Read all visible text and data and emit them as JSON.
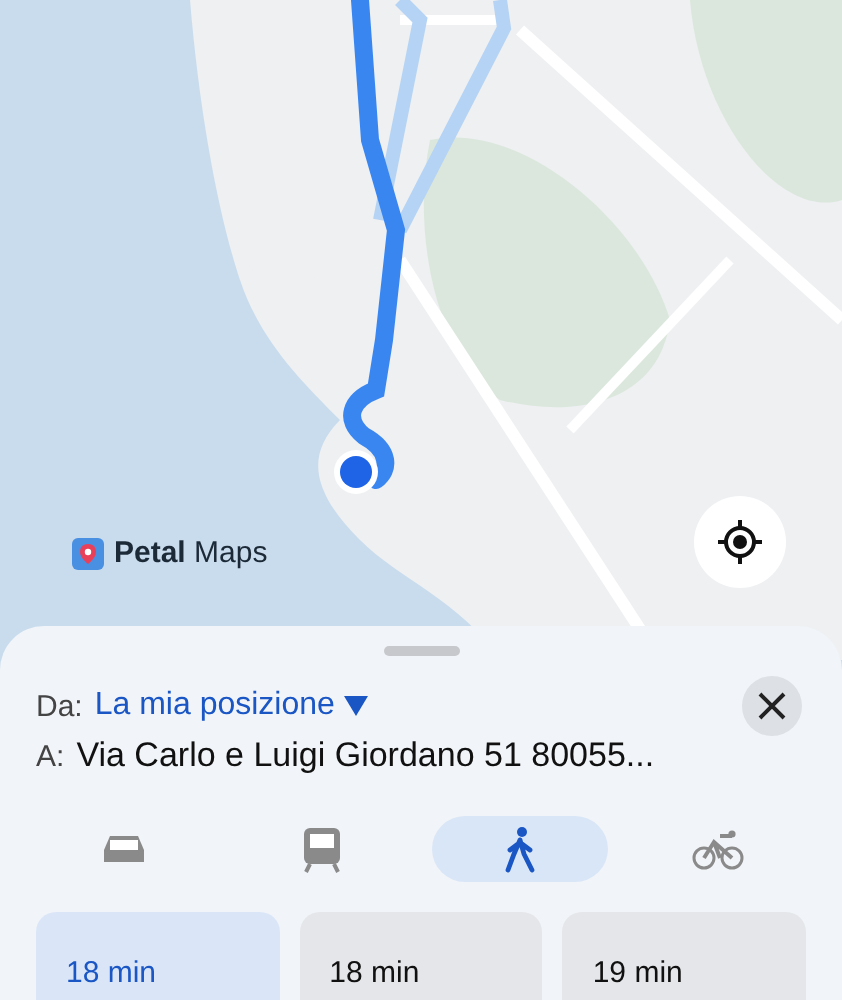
{
  "map": {
    "kind": "picture",
    "logo": "**Petal** Maps"
  },
  "sheet": {
    "from_label": "Da:",
    "from_value": "La mia posizione",
    "to_label": "A:",
    "to_value": "Via Carlo e Luigi Giordano 51 80055..."
  },
  "modes": [
    {
      "kind": "car",
      "selected": false
    },
    {
      "kind": "transit",
      "selected": false
    },
    {
      "kind": "walk",
      "selected": true
    },
    {
      "kind": "bike",
      "selected": false
    }
  ],
  "routes": [
    {
      "time": "18 min",
      "selected": true
    },
    {
      "time": "18 min",
      "selected": false
    },
    {
      "time": "19 min",
      "selected": false
    }
  ]
}
